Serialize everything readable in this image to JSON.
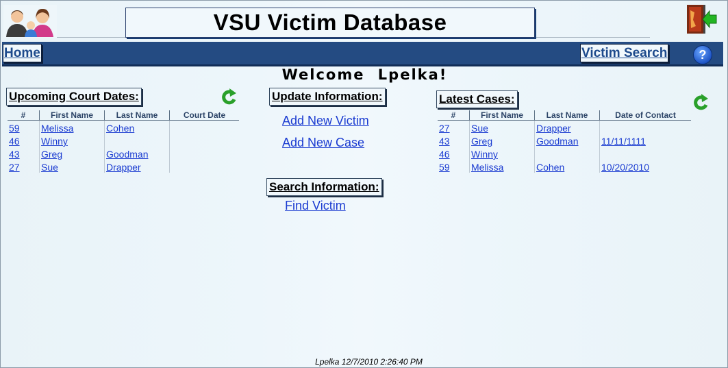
{
  "header": {
    "title": "VSU Victim Database"
  },
  "nav": {
    "home_label": "Home",
    "victim_search_label": "Victim Search",
    "help_label": "?"
  },
  "welcome": {
    "text": "Welcome Lpelka!"
  },
  "court": {
    "title": "Upcoming Court Dates:",
    "headers": [
      "#",
      "First Name",
      "Last Name",
      "Court Date"
    ],
    "rows": [
      {
        "id": "59",
        "first": "Melissa",
        "last": "Cohen",
        "date": ""
      },
      {
        "id": "46",
        "first": "Winny",
        "last": "",
        "date": ""
      },
      {
        "id": "43",
        "first": "Greg",
        "last": "Goodman",
        "date": ""
      },
      {
        "id": "27",
        "first": "Sue",
        "last": "Drapper",
        "date": ""
      }
    ]
  },
  "update": {
    "title": "Update Information:",
    "add_victim": "Add New Victim",
    "add_case": "Add New Case"
  },
  "search": {
    "title": "Search Information:",
    "find_victim": "Find Victim"
  },
  "cases": {
    "title": "Latest Cases:",
    "headers": [
      "#",
      "First Name",
      "Last Name",
      "Date of Contact"
    ],
    "rows": [
      {
        "id": "27",
        "first": "Sue",
        "last": "Drapper",
        "date": ""
      },
      {
        "id": "43",
        "first": "Greg",
        "last": "Goodman",
        "date": "11/11/1111"
      },
      {
        "id": "46",
        "first": "Winny",
        "last": "",
        "date": ""
      },
      {
        "id": "59",
        "first": "Melissa",
        "last": "Cohen",
        "date": "10/20/2010"
      }
    ]
  },
  "footer": {
    "text": "Lpelka 12/7/2010 2:26:40 PM"
  },
  "colors": {
    "navbar": "#244b82",
    "link": "#1a3bd1",
    "background": "#edf6fb",
    "refresh": "#2aa02a"
  },
  "icons": {
    "logo": "family-people-icon",
    "exit": "exit-door-icon",
    "help": "help-icon",
    "refresh": "refresh-icon"
  }
}
